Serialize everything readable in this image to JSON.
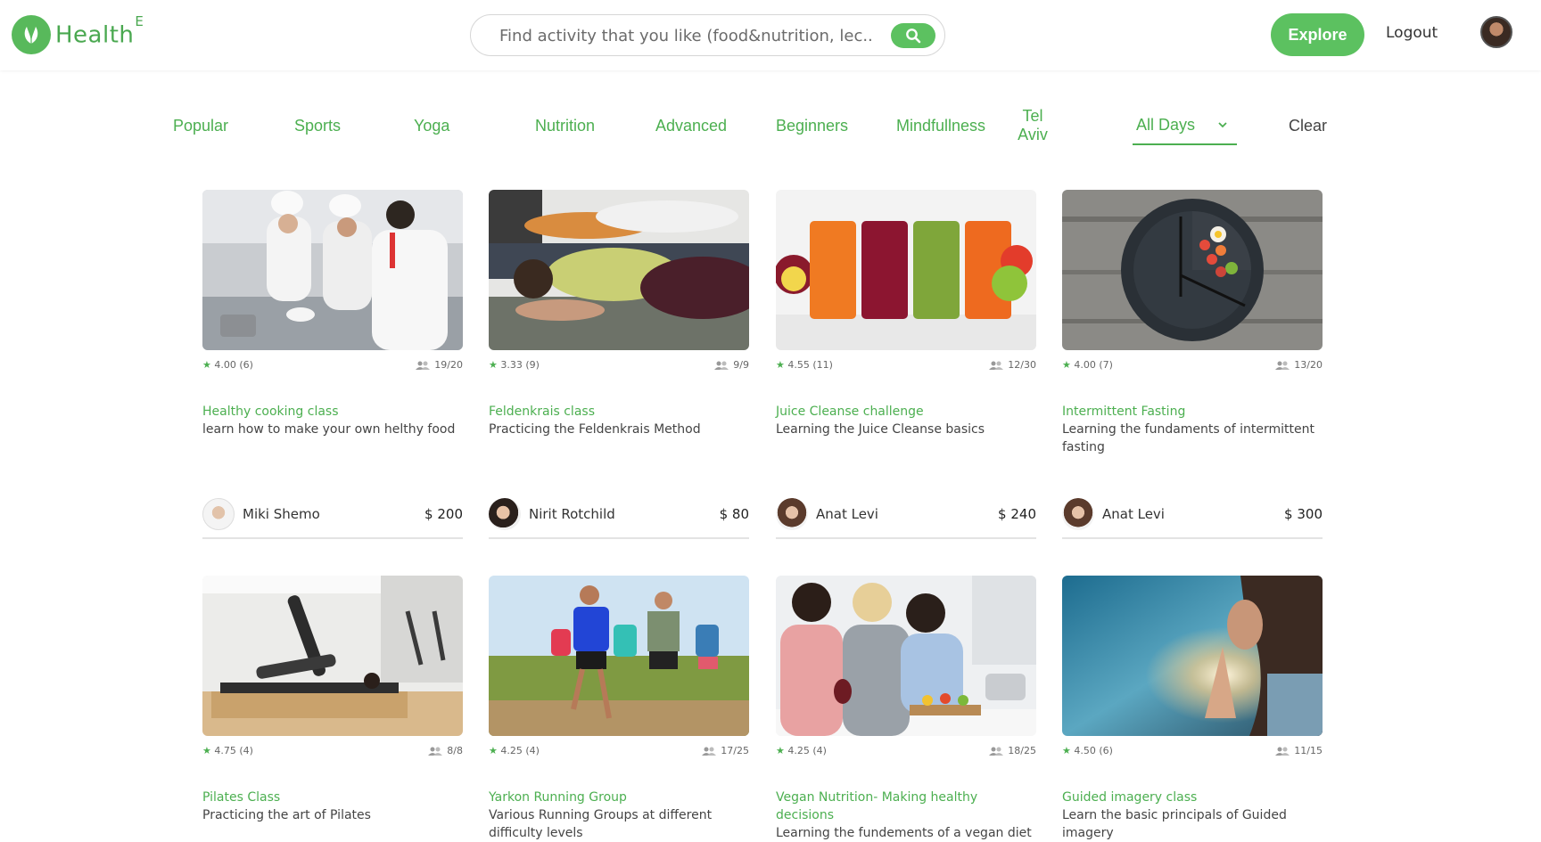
{
  "app": {
    "logo_text": "Health",
    "logo_sup": "E"
  },
  "colors": {
    "brand": "#5cc160",
    "accent_text": "#4caf50"
  },
  "search": {
    "placeholder": "Find activity that you like (food&nutrition, lec...",
    "icon": "search-icon"
  },
  "header": {
    "explore_label": "Explore",
    "logout_label": "Logout"
  },
  "filters": {
    "categories": [
      "Popular",
      "Sports",
      "Yoga",
      "Nutrition",
      "Advanced",
      "Beginners",
      "Mindfullness",
      "Tel Aviv"
    ],
    "tel_aviv_line1": "Tel",
    "tel_aviv_line2": "Aviv",
    "days_selected": "All Days",
    "clear_label": "Clear"
  },
  "cards": [
    {
      "rating": "4.00 (6)",
      "capacity": "19/20",
      "title": "Healthy cooking class",
      "desc": "learn how to make your own helthy food",
      "host": "Miki Shemo",
      "price": "$ 200"
    },
    {
      "rating": "3.33 (9)",
      "capacity": "9/9",
      "title": "Feldenkrais class",
      "desc": "Practicing the Feldenkrais Method",
      "host": "Nirit Rotchild",
      "price": "$ 80"
    },
    {
      "rating": "4.55 (11)",
      "capacity": "12/30",
      "title": "Juice Cleanse challenge",
      "desc": "Learning the Juice Cleanse basics",
      "host": "Anat Levi",
      "price": "$ 240"
    },
    {
      "rating": "4.00 (7)",
      "capacity": "13/20",
      "title": "Intermittent Fasting",
      "desc": "Learning the fundaments of intermittent fasting",
      "host": "Anat Levi",
      "price": "$ 300"
    },
    {
      "rating": "4.75 (4)",
      "capacity": "8/8",
      "title": "Pilates Class",
      "desc": "Practicing the art of Pilates",
      "host": "",
      "price": ""
    },
    {
      "rating": "4.25 (4)",
      "capacity": "17/25",
      "title": "Yarkon Running Group",
      "desc": "Various Running Groups at different difficulty levels",
      "host": "",
      "price": ""
    },
    {
      "rating": "4.25 (4)",
      "capacity": "18/25",
      "title": "Vegan Nutrition- Making healthy decisions",
      "desc": "Learning the fundements of a vegan diet",
      "host": "",
      "price": ""
    },
    {
      "rating": "4.50 (6)",
      "capacity": "11/15",
      "title": "Guided imagery class",
      "desc": "Learn the basic principals of Guided imagery",
      "host": "",
      "price": ""
    }
  ]
}
